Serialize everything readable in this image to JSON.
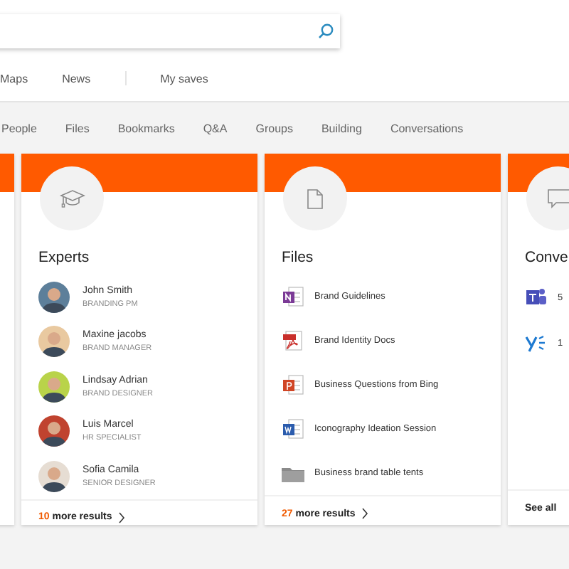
{
  "nav": [
    {
      "kind": "link",
      "label": "Maps"
    },
    {
      "kind": "link",
      "label": "News"
    },
    {
      "kind": "separator"
    },
    {
      "kind": "link",
      "label": "My saves"
    }
  ],
  "tabs": [
    {
      "label": "People",
      "selected": false
    },
    {
      "label": "Files",
      "selected": false
    },
    {
      "label": "Bookmarks",
      "selected": false
    },
    {
      "label": "Q&A",
      "selected": false
    },
    {
      "label": "Groups",
      "selected": false
    },
    {
      "label": "Building",
      "selected": false
    },
    {
      "label": "Conversations",
      "selected": false
    }
  ],
  "cards": [
    {
      "kind": "blank"
    },
    {
      "kind": "people",
      "title": "Experts",
      "items": [
        {
          "name": "John Smith",
          "role": "BRANDING PM",
          "color": "#5d7f9a"
        },
        {
          "name": "Maxine jacobs",
          "role": "BRAND MANAGER",
          "color": "#e9c9a0"
        },
        {
          "name": "Lindsay Adrian",
          "role": "BRAND DESIGNER",
          "color": "#b9d34a"
        },
        {
          "name": "Luis Marcel",
          "role": "HR SPECIALIST",
          "color": "#c0432f"
        },
        {
          "name": "Sofia Camila",
          "role": "SENIOR DESIGNER",
          "color": "#e6ddd3"
        }
      ],
      "footer": {
        "count": "10",
        "label": "more results"
      }
    },
    {
      "kind": "files",
      "title": "Files",
      "items": [
        {
          "kind": "onenote",
          "name": "Brand Guidelines"
        },
        {
          "kind": "pdf",
          "name": "Brand Identity Docs"
        },
        {
          "kind": "powerpoint",
          "name": "Business Questions from Bing"
        },
        {
          "kind": "word",
          "name": "Iconography Ideation Session"
        },
        {
          "kind": "folder",
          "name": "Business brand table tents"
        }
      ],
      "footer": {
        "count": "27",
        "label": "more results"
      }
    },
    {
      "kind": "conversations",
      "title": "Conve",
      "items": [
        {
          "kind": "teams",
          "text": "5"
        },
        {
          "kind": "yammer",
          "text": "1"
        }
      ],
      "footer": {
        "label": "See all"
      }
    }
  ]
}
